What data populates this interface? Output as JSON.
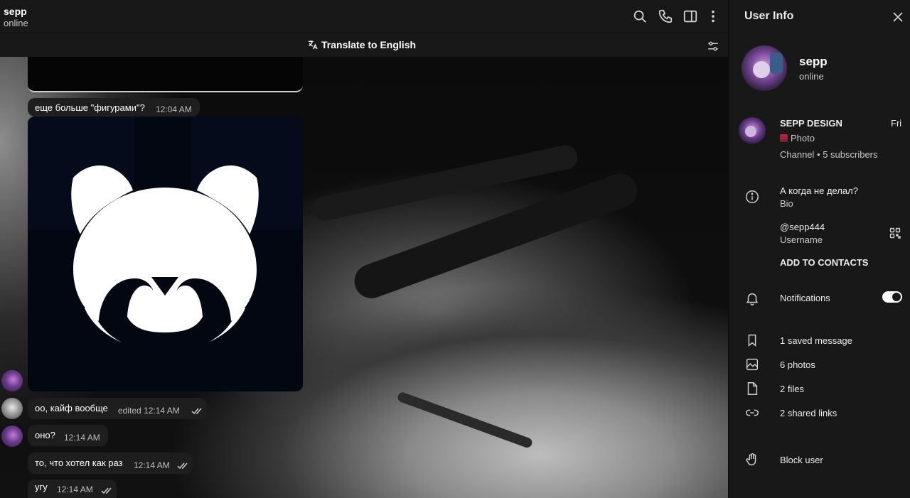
{
  "chat": {
    "title": "sepp",
    "status": "online",
    "translate_label": "Translate to English",
    "icons": [
      "search-icon",
      "phone-icon",
      "sidebar-toggle-icon",
      "more-vertical-icon"
    ]
  },
  "messages": [
    {
      "text": "еще больше \"фигурами\"?",
      "time": "12:04 AM"
    },
    {
      "text": "оо, кайф вообще",
      "edited": "edited",
      "time": "12:14 AM"
    },
    {
      "text": "оно?",
      "time": "12:14 AM"
    },
    {
      "text": "то, что хотел как раз",
      "time": "12:14 AM"
    },
    {
      "text": "угу",
      "time": "12:14 AM"
    }
  ],
  "info": {
    "header": "User Info",
    "name": "sepp",
    "status": "online",
    "channel": {
      "name": "SEPP DESIGN",
      "date": "Fri",
      "last": "Photo",
      "meta": "Channel • 5 subscribers"
    },
    "bio": {
      "value": "А когда не делал?",
      "label": "Bio"
    },
    "username": {
      "value": "@sepp444",
      "label": "Username"
    },
    "add_contacts": "ADD TO CONTACTS",
    "notifications": "Notifications",
    "notifications_on": true,
    "media": {
      "saved": "1 saved message",
      "photos": "6 photos",
      "files": "2 files",
      "links": "2 shared links"
    },
    "block": "Block user"
  },
  "colors": {
    "panel": "#181818",
    "bubble": "#1e1e1e",
    "image_bg": "#030711"
  }
}
